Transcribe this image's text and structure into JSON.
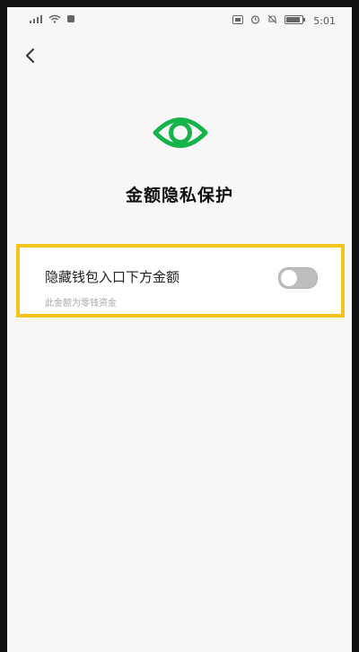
{
  "status_bar": {
    "left_icons": [
      "signal-icon",
      "wifi-icon",
      "notification-icon"
    ],
    "right_icons": [
      "nfc-icon",
      "alarm-icon",
      "mute-icon",
      "battery-icon"
    ],
    "time": "5:01"
  },
  "page": {
    "title": "金额隐私保护",
    "icon": "eye-icon",
    "accent_color": "#17b34a"
  },
  "setting": {
    "label": "隐藏钱包入口下方金额",
    "description": "此金额为零钱资金",
    "enabled": false
  }
}
